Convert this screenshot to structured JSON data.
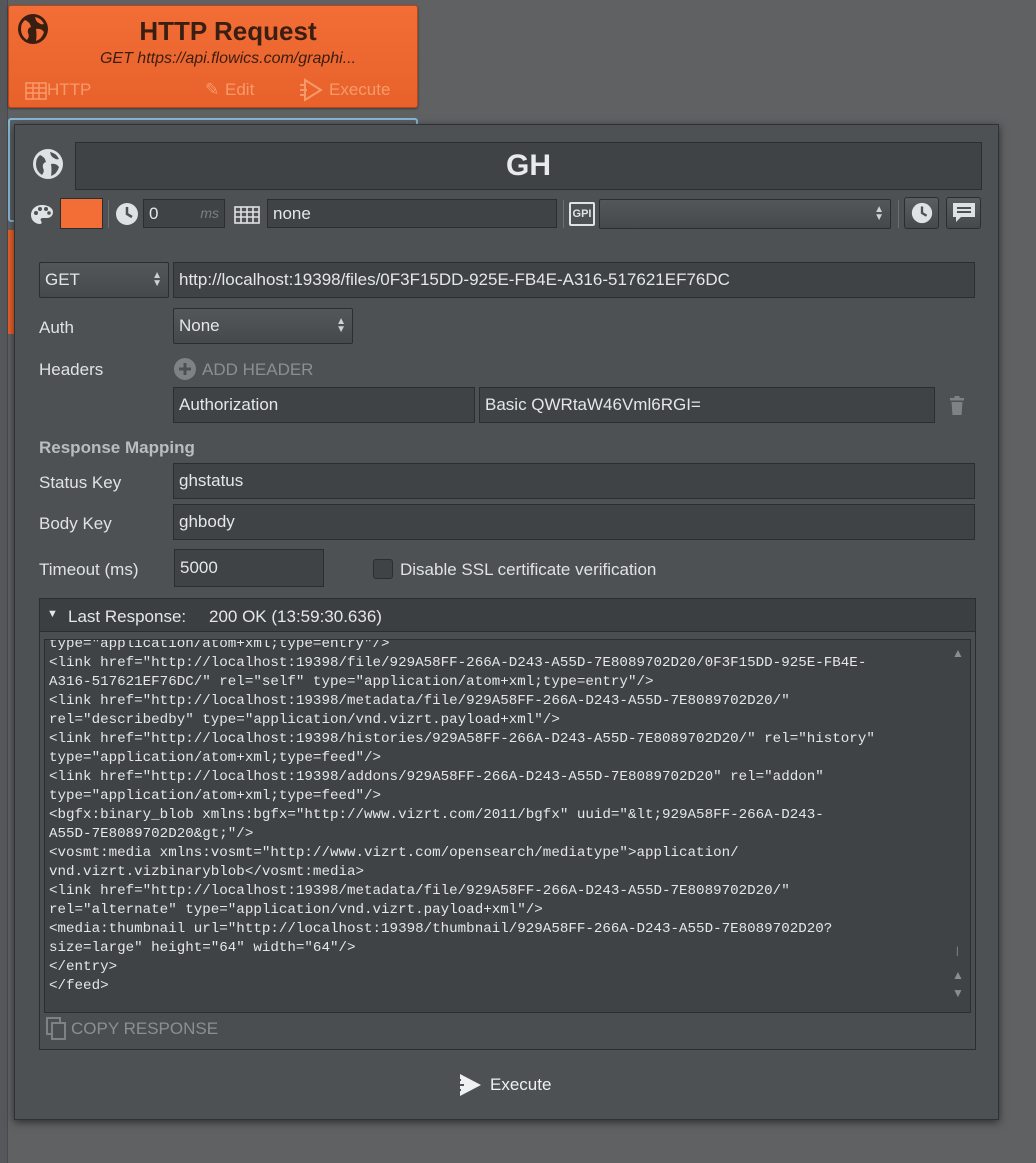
{
  "background_card": {
    "title": "HTTP Request",
    "subtitle": "GET https://api.flowics.com/graphi...",
    "footer": {
      "http_label": "HTTP",
      "edit_label": "Edit",
      "execute_label": "Execute"
    }
  },
  "dialog": {
    "name": "GH",
    "toolbar": {
      "color": "#f26e36",
      "delay_value": "0",
      "delay_unit": "ms",
      "keyboard_value": "none",
      "gpi_label": "GPI",
      "gpi_value": ""
    },
    "request": {
      "method": "GET",
      "url": "http://localhost:19398/files/0F3F15DD-925E-FB4E-A316-517621EF76DC",
      "auth_label": "Auth",
      "auth_value": "None",
      "headers_label": "Headers",
      "add_header_label": "ADD HEADER",
      "headers": [
        {
          "key": "Authorization",
          "value": "Basic QWRtaW46Vml6RGI="
        }
      ]
    },
    "response_mapping": {
      "title": "Response Mapping",
      "status_key_label": "Status Key",
      "status_key_value": "ghstatus",
      "body_key_label": "Body Key",
      "body_key_value": "ghbody",
      "timeout_label": "Timeout (ms)",
      "timeout_value": "5000",
      "ssl_label": "Disable SSL certificate verification",
      "ssl_checked": false
    },
    "last_response": {
      "label": "Last Response:",
      "status": "200 OK (13:59:30.636)",
      "body": "type=\"application/atom+xml;type=entry\"/>\n<link href=\"http://localhost:19398/file/929A58FF-266A-D243-A55D-7E8089702D20/0F3F15DD-925E-FB4E-\nA316-517621EF76DC/\" rel=\"self\" type=\"application/atom+xml;type=entry\"/>\n<link href=\"http://localhost:19398/metadata/file/929A58FF-266A-D243-A55D-7E8089702D20/\"\nrel=\"describedby\" type=\"application/vnd.vizrt.payload+xml\"/>\n<link href=\"http://localhost:19398/histories/929A58FF-266A-D243-A55D-7E8089702D20/\" rel=\"history\"\ntype=\"application/atom+xml;type=feed\"/>\n<link href=\"http://localhost:19398/addons/929A58FF-266A-D243-A55D-7E8089702D20\" rel=\"addon\"\ntype=\"application/atom+xml;type=feed\"/>\n<bgfx:binary_blob xmlns:bgfx=\"http://www.vizrt.com/2011/bgfx\" uuid=\"&lt;929A58FF-266A-D243-\nA55D-7E8089702D20&gt;\"/>\n<vosmt:media xmlns:vosmt=\"http://www.vizrt.com/opensearch/mediatype\">application/\nvnd.vizrt.vizbinaryblob</vosmt:media>\n<link href=\"http://localhost:19398/metadata/file/929A58FF-266A-D243-A55D-7E8089702D20/\"\nrel=\"alternate\" type=\"application/vnd.vizrt.payload+xml\"/>\n<media:thumbnail url=\"http://localhost:19398/thumbnail/929A58FF-266A-D243-A55D-7E8089702D20?\nsize=large\" height=\"64\" width=\"64\"/>\n</entry>\n</feed>",
      "copy_label": "COPY RESPONSE"
    },
    "execute_label": "Execute"
  }
}
